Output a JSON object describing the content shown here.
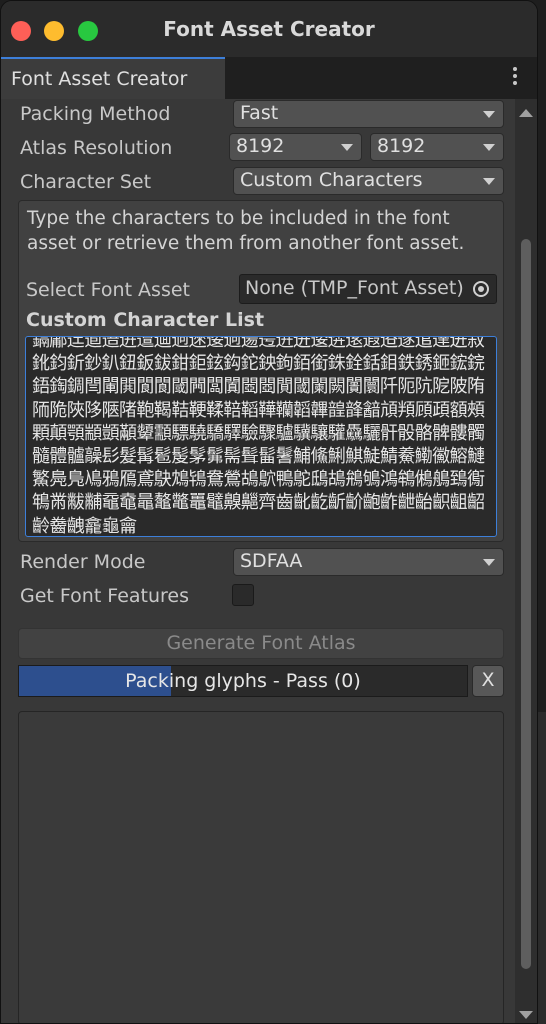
{
  "window": {
    "title": "Font Asset Creator"
  },
  "tab": {
    "label": "Font Asset Creator",
    "menu_icon": "kebab-menu-icon"
  },
  "settings": {
    "packing_method": {
      "label": "Packing Method",
      "value": "Fast"
    },
    "atlas_resolution": {
      "label": "Atlas Resolution",
      "width": "8192",
      "height": "8192"
    },
    "character_set": {
      "label": "Character Set",
      "value": "Custom Characters"
    },
    "help": "Type the characters to be included in the font asset or retrieve them from another font asset.",
    "select_font_asset": {
      "label": "Select Font Asset",
      "value": "None (TMP_Font Asset)"
    },
    "custom_list": {
      "label": "Custom Character List",
      "text": "鎘鄘迋逌逜逬邅逥迵逨逶迵逿遌逬迸逶逩逺遐逧遂逭達迸叙鈋鈞釿鈔釟鈕鈑鈸鉗鉅鉉鈎鉈鉠鉤銆銜銖銓銛鉬鉄銹鉔鋐鋎鋙鋾錭閆閳閧閬閬閾闁闆闐閸閸閴閾闌闕闠闤阡阨阬阸陂陏陑陒陜陊陿陼鞄鞨鞊鞕鞣鞛鞱鞾韊韜韠韹韸韽頏頖頋頙額頰顆顛顎顓顗顢顰顬驃驍驕驛驗驟驢驥驤驩驫驪骭骰骼髀髏髑髓體髗髞髟髮髯髱髲髳髴髵髶髷鬐鯆鯈鯏鯕鯐鯖鯗鰳鰴鰫鰱鰵鳧鳬鳰鴉鴈鳶鴃鴆鴇鴦鶯鴣鴥鴨鴕鴟鴣鴘鴝鴻鴾鵂鵃鵄鵆鵇黹黻黼黿鼀鼂鼇鼈鼉鼊齅齆齊齒齔齕齗齘齙齚齛齝齞齟齠齡齤齥龕龜龠"
    },
    "render_mode": {
      "label": "Render Mode",
      "value": "SDFAA"
    },
    "get_font_features": {
      "label": "Get Font Features",
      "checked": false
    }
  },
  "actions": {
    "generate_label": "Generate Font Atlas",
    "progress_text": "Packing glyphs - Pass (0)",
    "progress_fraction": 0.34,
    "cancel_label": "X"
  },
  "colors": {
    "accent": "#3d7fd9",
    "progress_fill": "#2d4f8e",
    "traffic_red": "#fe5f57",
    "traffic_yellow": "#febc2e",
    "traffic_green": "#28c840"
  }
}
